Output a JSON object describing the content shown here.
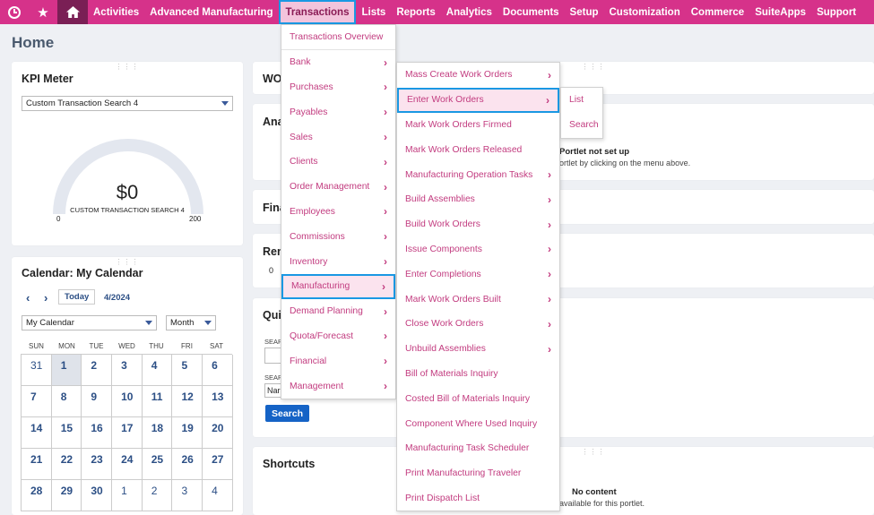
{
  "nav": {
    "items": [
      "Activities",
      "Advanced Manufacturing",
      "Transactions",
      "Lists",
      "Reports",
      "Analytics",
      "Documents",
      "Setup",
      "Customization",
      "Commerce",
      "SuiteApps",
      "Support"
    ]
  },
  "page": {
    "title": "Home"
  },
  "kpi": {
    "title": "KPI Meter",
    "select_value": "Custom Transaction Search 4",
    "value": "$0",
    "label": "CUSTOM TRANSACTION SEARCH 4",
    "min": "0",
    "max": "200"
  },
  "calendar": {
    "title": "Calendar: My Calendar",
    "today_label": "Today",
    "month": "4/2024",
    "calendar_select": "My Calendar",
    "view_select": "Month",
    "dow": [
      "SUN",
      "MON",
      "TUE",
      "WED",
      "THU",
      "FRI",
      "SAT"
    ],
    "days": [
      "31",
      "1",
      "2",
      "3",
      "4",
      "5",
      "6",
      "7",
      "8",
      "9",
      "10",
      "11",
      "12",
      "13",
      "14",
      "15",
      "16",
      "17",
      "18",
      "19",
      "20",
      "21",
      "22",
      "23",
      "24",
      "25",
      "26",
      "27",
      "28",
      "29",
      "30",
      "1",
      "2",
      "3",
      "4"
    ]
  },
  "portlets": {
    "wo_title": "WO",
    "ana_title": "Ana",
    "fina_title": "Fina",
    "rem_title": "Rem",
    "rem_value": "0",
    "qui_title": "Qui",
    "search_label_1": "SEAR",
    "search_label_2": "SEAR",
    "search_input_2": "Nar",
    "search_button": "Search",
    "not_setup_title": "Portlet not set up",
    "not_setup_text": "ortlet by clicking on the menu above.",
    "shortcuts_title": "Shortcuts",
    "no_content_title": "No content",
    "no_content_text": "available for this portlet."
  },
  "menu1": [
    {
      "label": "Transactions Overview",
      "arrow": false
    },
    {
      "label": "Bank",
      "arrow": true
    },
    {
      "label": "Purchases",
      "arrow": true
    },
    {
      "label": "Payables",
      "arrow": true
    },
    {
      "label": "Sales",
      "arrow": true
    },
    {
      "label": "Clients",
      "arrow": true
    },
    {
      "label": "Order Management",
      "arrow": true
    },
    {
      "label": "Employees",
      "arrow": true
    },
    {
      "label": "Commissions",
      "arrow": true
    },
    {
      "label": "Inventory",
      "arrow": true
    },
    {
      "label": "Manufacturing",
      "arrow": true
    },
    {
      "label": "Demand Planning",
      "arrow": true
    },
    {
      "label": "Quota/Forecast",
      "arrow": true
    },
    {
      "label": "Financial",
      "arrow": true
    },
    {
      "label": "Management",
      "arrow": true
    }
  ],
  "menu2": [
    {
      "label": "Mass Create Work Orders",
      "arrow": true
    },
    {
      "label": "Enter Work Orders",
      "arrow": true
    },
    {
      "label": "Mark Work Orders Firmed",
      "arrow": false
    },
    {
      "label": "Mark Work Orders Released",
      "arrow": false
    },
    {
      "label": "Manufacturing Operation Tasks",
      "arrow": true
    },
    {
      "label": "Build Assemblies",
      "arrow": true
    },
    {
      "label": "Build Work Orders",
      "arrow": true
    },
    {
      "label": "Issue Components",
      "arrow": true
    },
    {
      "label": "Enter Completions",
      "arrow": true
    },
    {
      "label": "Mark Work Orders Built",
      "arrow": true
    },
    {
      "label": "Close Work Orders",
      "arrow": true
    },
    {
      "label": "Unbuild Assemblies",
      "arrow": true
    },
    {
      "label": "Bill of Materials Inquiry",
      "arrow": false
    },
    {
      "label": "Costed Bill of Materials Inquiry",
      "arrow": false
    },
    {
      "label": "Component Where Used Inquiry",
      "arrow": false
    },
    {
      "label": "Manufacturing Task Scheduler",
      "arrow": false
    },
    {
      "label": "Print Manufacturing Traveler",
      "arrow": false
    },
    {
      "label": "Print Dispatch List",
      "arrow": false
    }
  ],
  "menu3": [
    {
      "label": "List"
    },
    {
      "label": "Search"
    }
  ],
  "colors": {
    "nav": "#d6328a",
    "menu_text": "#c23b7f",
    "highlight_border": "#1a98e3"
  }
}
